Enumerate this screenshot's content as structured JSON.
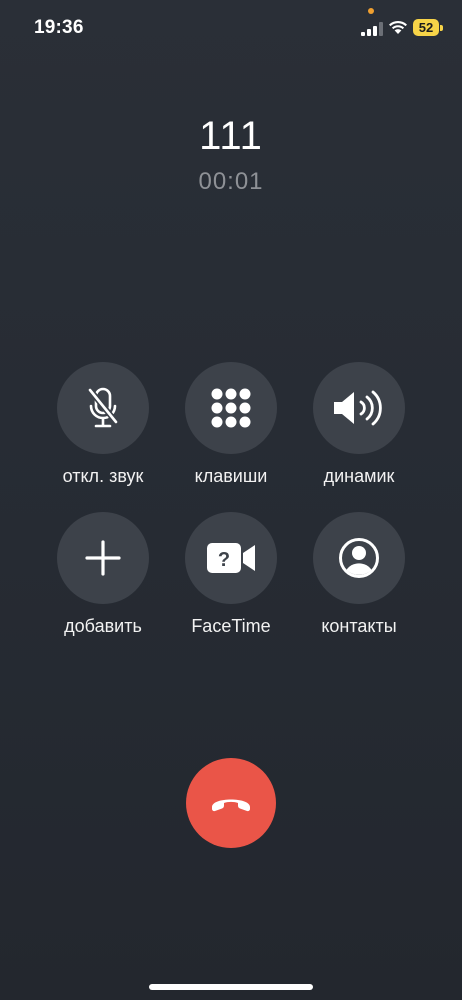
{
  "status_bar": {
    "time": "19:36",
    "battery_level": "52",
    "privacy_dot_color": "#f0a030",
    "battery_color": "#f7d448"
  },
  "call": {
    "caller": "111",
    "duration": "00:01"
  },
  "controls": [
    {
      "id": "mute",
      "label": "откл. звук",
      "icon": "mic-off-icon"
    },
    {
      "id": "keypad",
      "label": "клавиши",
      "icon": "keypad-icon"
    },
    {
      "id": "speaker",
      "label": "динамик",
      "icon": "speaker-icon"
    },
    {
      "id": "add-call",
      "label": "добавить",
      "icon": "plus-icon"
    },
    {
      "id": "facetime",
      "label": "FaceTime",
      "icon": "facetime-video-icon"
    },
    {
      "id": "contacts",
      "label": "контакты",
      "icon": "contact-icon"
    }
  ],
  "end_call": {
    "icon": "hang-up-icon",
    "color": "#ea5548"
  }
}
